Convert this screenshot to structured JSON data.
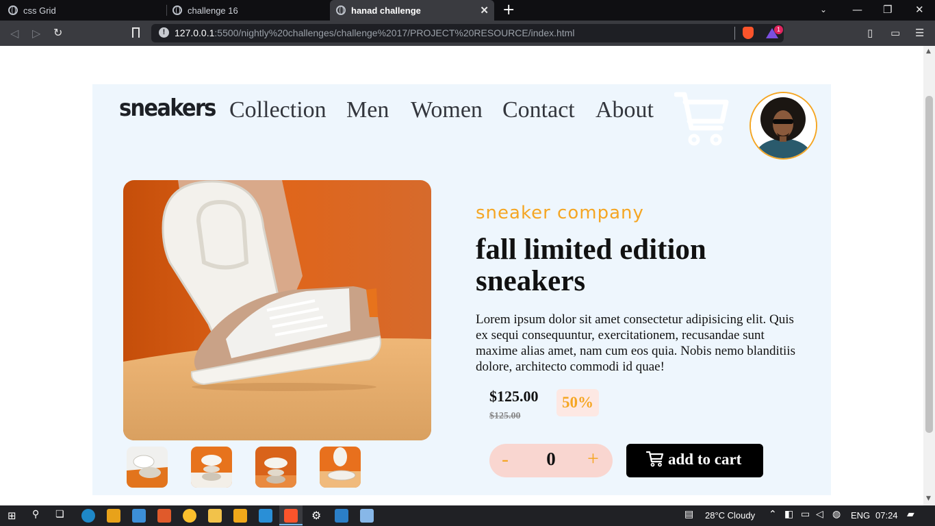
{
  "browser": {
    "tabs": [
      {
        "title": "css Grid",
        "active": false
      },
      {
        "title": "challenge 16",
        "active": false
      },
      {
        "title": "hanad challenge",
        "active": true
      }
    ],
    "url_host": "127.0.0.1",
    "url_rest": ":5500/nightly%20challenges/challenge%2017/PROJECT%20RESOURCE/index.html",
    "badge_count": "1",
    "info_icon": "!"
  },
  "page": {
    "logo": "sneakers",
    "nav": [
      "Collection",
      "Men",
      "Women",
      "Contact",
      "About"
    ],
    "company": "sneaker company",
    "title": "fall limited edition sneakers",
    "description": "Lorem ipsum dolor sit amet consectetur adipisicing elit. Quis ex sequi consequuntur, exercitationem, recusandae sunt maxime alias amet, nam cum eos quia. Nobis nemo blanditiis dolore, architecto commodi id quae!",
    "price": "$125.00",
    "old_price": "$125.00",
    "discount": "50%",
    "quantity": {
      "minus": "-",
      "value": "0",
      "plus": "+"
    },
    "add_to_cart": "add to cart",
    "thumbnails": 4
  },
  "colors": {
    "accent_orange": "#f5a623",
    "card_bg": "#eef6fd",
    "qty_bg": "#f9d6d0",
    "button_bg": "#000000"
  },
  "taskbar": {
    "weather": "28°C  Cloudy",
    "language": "ENG",
    "time": "07:24"
  }
}
